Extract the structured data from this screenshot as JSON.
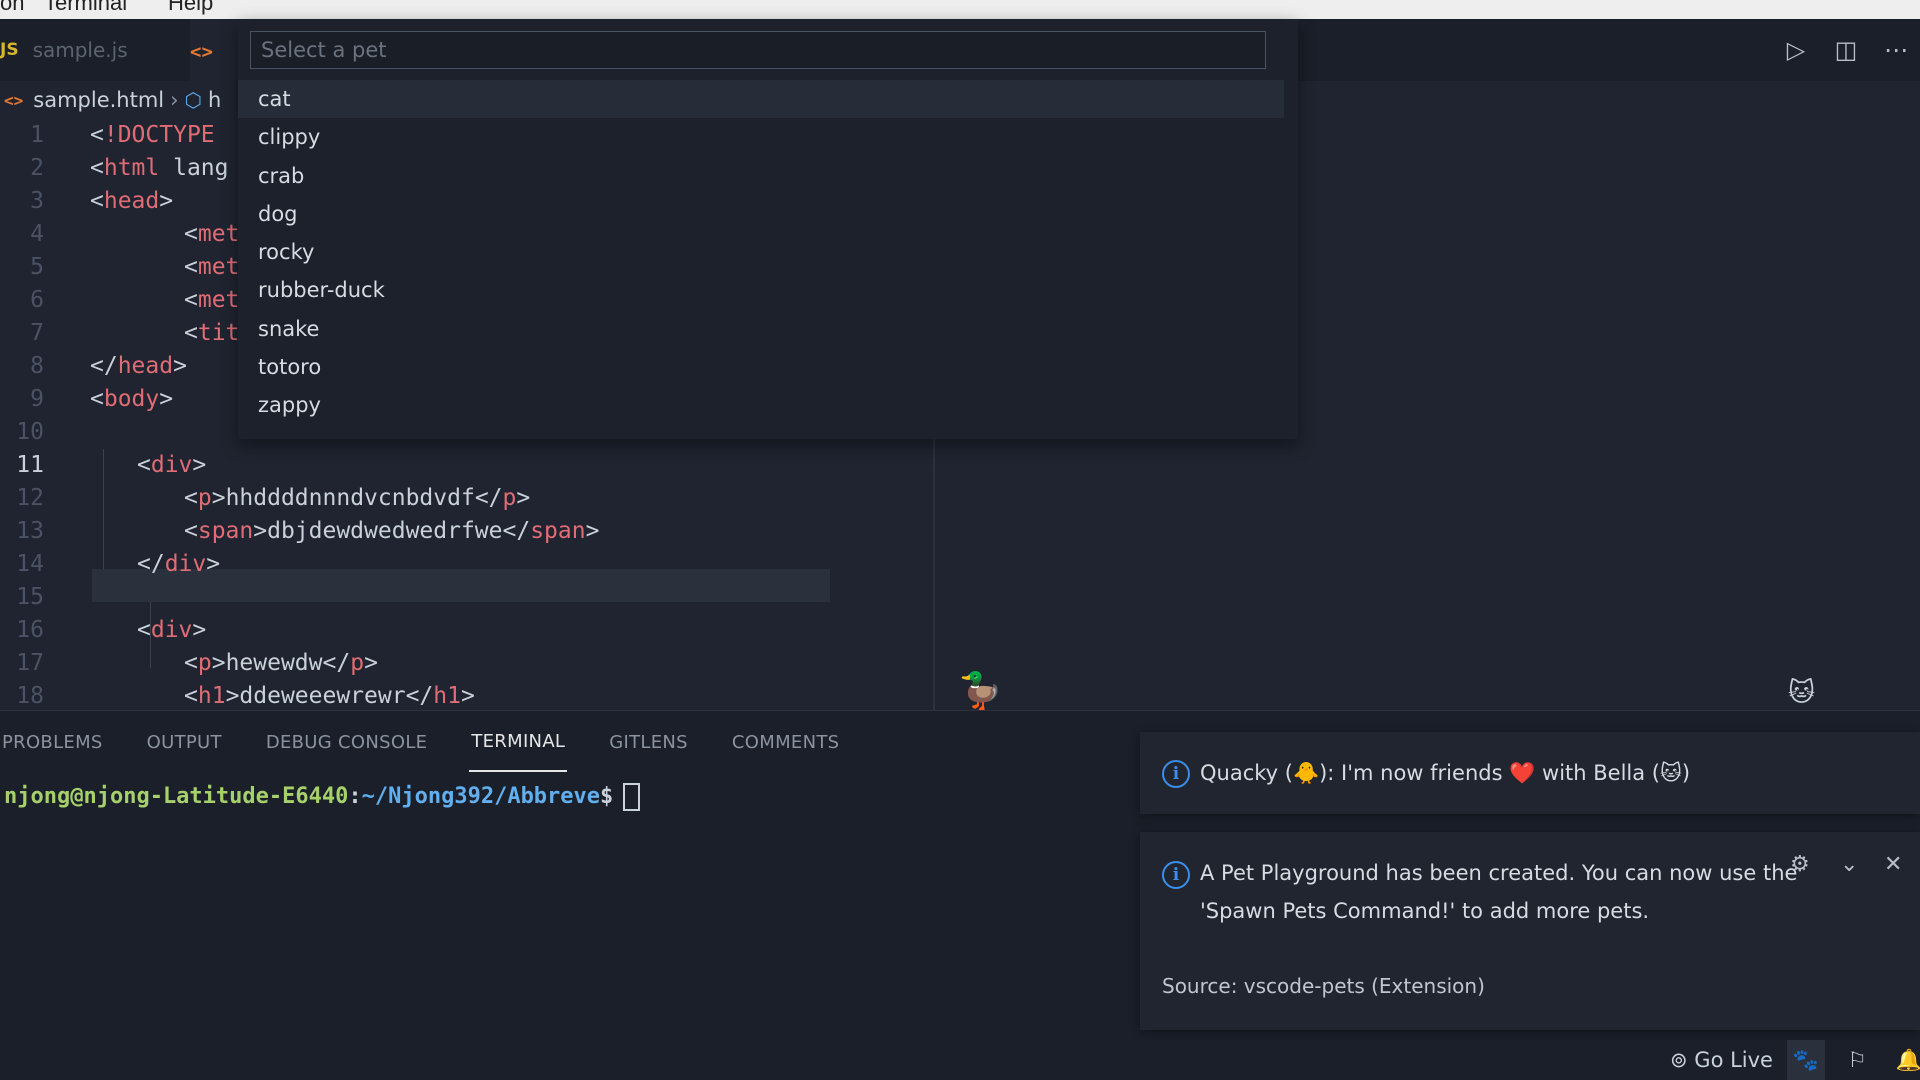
{
  "menubar": {
    "items": [
      "on",
      "Terminal",
      "Help"
    ]
  },
  "tabs": [
    {
      "label": "sample.js",
      "icon": "js-file-icon"
    },
    {
      "label": "",
      "icon": "html-code-icon"
    }
  ],
  "tab_actions": [
    "run-icon",
    "split-editor-icon",
    "more-actions-icon"
  ],
  "breadcrumb": {
    "file": "sample.html",
    "symbol": "h"
  },
  "quick_pick": {
    "placeholder": "Select a pet",
    "items": [
      "cat",
      "clippy",
      "crab",
      "dog",
      "rocky",
      "rubber-duck",
      "snake",
      "totoro",
      "zappy"
    ],
    "active_index": 0
  },
  "editor": {
    "current_line": 11,
    "lines": [
      {
        "n": "1",
        "text": "<!DOCTYPE"
      },
      {
        "n": "2",
        "text": "<html lang"
      },
      {
        "n": "3",
        "text": "<head>"
      },
      {
        "n": "4",
        "text": "<meta"
      },
      {
        "n": "5",
        "text": "<meta"
      },
      {
        "n": "6",
        "text": "<meta"
      },
      {
        "n": "7",
        "text": "<title"
      },
      {
        "n": "8",
        "text": "</head>"
      },
      {
        "n": "9",
        "text": "<body>"
      },
      {
        "n": "10",
        "text": ""
      },
      {
        "n": "11",
        "text": "<div>"
      },
      {
        "n": "12",
        "text": "<p>hhddddnnndvcnbdvdf</p>"
      },
      {
        "n": "13",
        "text": "<span>dbjdewdwedwedrfwe</span>"
      },
      {
        "n": "14",
        "text": "</div>"
      },
      {
        "n": "15",
        "text": ""
      },
      {
        "n": "16",
        "text": "<div>"
      },
      {
        "n": "17",
        "text": "<p>hewewdw</p>"
      },
      {
        "n": "18",
        "text": "<h1>ddeweeewrewr</h1>"
      }
    ]
  },
  "pets": {
    "duck": "🦆",
    "cat": "🐱"
  },
  "panel": {
    "tabs": [
      "PROBLEMS",
      "OUTPUT",
      "DEBUG CONSOLE",
      "TERMINAL",
      "GITLENS",
      "COMMENTS"
    ],
    "active_tab": "TERMINAL"
  },
  "terminal": {
    "user": "njong@njong-Latitude-E6440",
    "colon": ":",
    "path": "~/Njong392/Abbreve",
    "prompt": "$"
  },
  "notifications": [
    {
      "text": "Quacky (🐥): I'm now friends ❤️ with Bella (🐱)"
    },
    {
      "text_line1": "A Pet Playground has been created. You can now use the",
      "text_line2": "'Spawn Pets Command!' to add more pets.",
      "source": "Source: vscode-pets (Extension)"
    }
  ],
  "statusbar": {
    "go_live": "Go Live"
  }
}
